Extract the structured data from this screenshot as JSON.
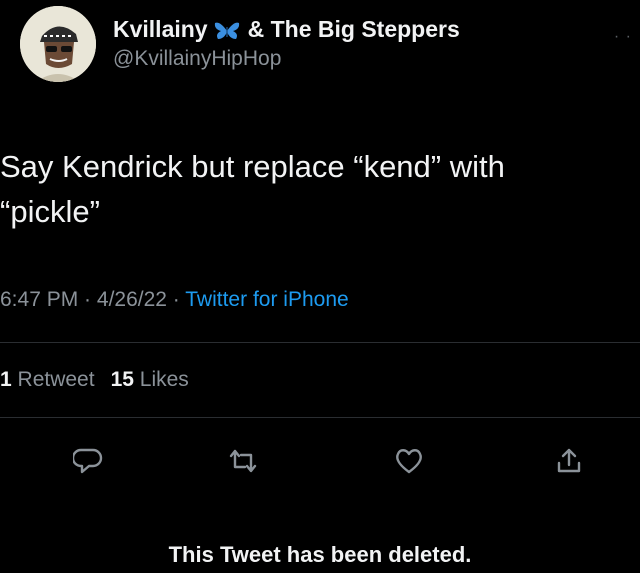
{
  "tweet": {
    "author": {
      "display_name": "Kvillainy",
      "name_suffix": "& The Big Steppers",
      "handle": "@KvillainyHipHop"
    },
    "text": "Say Kendrick but replace “kend” with\n“pickle”",
    "meta": {
      "time": "6:47 PM",
      "separator": " · ",
      "date": "4/26/22",
      "source": "Twitter for iPhone"
    },
    "stats": {
      "retweets_count": "1",
      "retweets_label": "Retweet",
      "likes_count": "15",
      "likes_label": "Likes"
    },
    "actions": [
      "reply-icon",
      "retweet-icon",
      "heart-icon",
      "share-icon"
    ],
    "deleted_notice": "This Tweet has been deleted."
  },
  "colors": {
    "background": "#000000",
    "primary_text": "#f2f3f4",
    "secondary_text": "#8b9299",
    "link": "#1d9bf0",
    "divider": "#2a2d31",
    "butterfly": "#3b8fe0"
  }
}
